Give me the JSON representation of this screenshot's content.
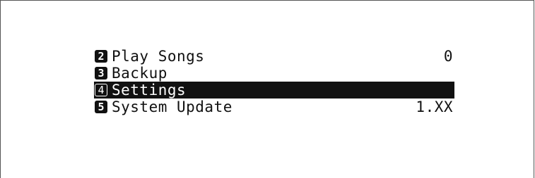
{
  "menu": {
    "items": [
      {
        "number": "2",
        "label": "Play Songs",
        "value": "0",
        "selected": false
      },
      {
        "number": "3",
        "label": "Backup",
        "value": "",
        "selected": false
      },
      {
        "number": "4",
        "label": "Settings",
        "value": "",
        "selected": true
      },
      {
        "number": "5",
        "label": "System Update",
        "value": "1.XX",
        "selected": false
      }
    ]
  },
  "colors": {
    "background": "#ffffff",
    "text": "#111111",
    "highlight": "#111111",
    "highlight_text": "#ffffff"
  }
}
